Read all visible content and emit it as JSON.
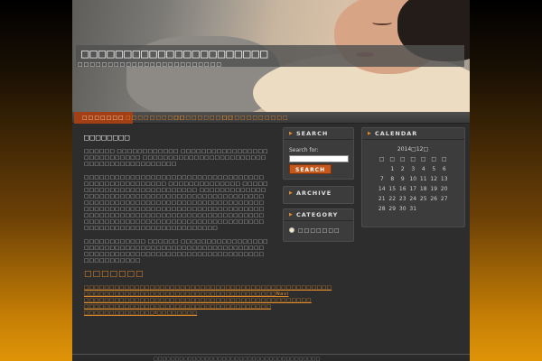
{
  "site": {
    "title": "□□□□□□□□□□□□□□□□□□□□□□",
    "description": "□□□□□□□□□□□□□□□□□□□□□□□□"
  },
  "nav": {
    "items": [
      {
        "label": "□□□□□□□",
        "active": true
      },
      {
        "label": "□□□□□□□□□□",
        "active": false
      },
      {
        "label": "□□□□□□□□□□",
        "active": false
      },
      {
        "label": "□□□□□□□",
        "active": false
      },
      {
        "label": "□□□□",
        "active": false
      }
    ]
  },
  "content": {
    "title": "□□□□□□□□",
    "paragraphs": [
      "□□□□□□ □□□□□□□□□□□□ □□□□□□□□□□□□□□□□□□□□□□□□□□□□ □□□□□□□□□□□□□□□□□□□□□□□□ □□□□□□□□□□□□□□□□□□",
      "□□□□□□□□□□□□□□□□□□□□□□□□□□□□□□□□□□□□□□□□□□□□□□□□□□□ □□□□□□□□□□□□□□ □□□□□□□□□□□□□□□□□□□□□□□□□□□ □□□□□□□□□□□□□□□□□□□□□□□□□□□□□□□□□□□□□□□□□□□□□□□□□□□□□□□□□□□□□□□□□□□□□□□□□□□□□□□□□□□□□□□□□□□□□□□□□□□□□□□□□□□□□□□□□□□□□□□□□□□□□□□□□□□□□□□□□□□□□□□□□□□□□□□□□□□□□□□□□□□□□□□□□□□□□□□□□□□□□□□□□□□□□□□□□□□□□□□□□□□□□□□□□□□□□□",
      "□□□□□□□□□□□□ □□□□□□ □□□□□□□□□□□□□□□□□□□□□□□□□□□□□□□□□□□□□□□□□□□□□□□□□□□□□□□□□□□□□□□□□□□□□□□□□□□□□□□□□□□□□□□□□□□□□□□□□□"
    ],
    "subtitle": "□□□□□□□",
    "links": [
      "□□□□□□□□□□□□□□□□□□□□□□□□□□□□□□□□□□□□□□□□□□□□□□□□□",
      "□□□□□□□□□□□□□□□□□□□□□□□□□□□□□□□□□□□□□□Navi",
      "□□□□□□□□□□□□□□□□□□□□□□□□□□□□□□□□□□□□□□□□□□□□□",
      "□□□□□□□□□□□□□□□□□□□□□□□□□□□□□□□□□□□□□",
      "□□□□□□□□□□□□□□I□□□□□□□□"
    ]
  },
  "sidebar": {
    "search": {
      "title": "SEARCH",
      "label": "Search for:",
      "button": "SEARCH",
      "value": ""
    },
    "archive": {
      "title": "ARCHIVE"
    },
    "category": {
      "title": "CATEGORY",
      "item": "□□□□□□□"
    },
    "calendar": {
      "title": "CALENDAR",
      "caption": "2014□12□",
      "weekdays": [
        "□",
        "□",
        "□",
        "□",
        "□",
        "□",
        "□"
      ],
      "weeks": [
        [
          "",
          "1",
          "2",
          "3",
          "4",
          "5",
          "6"
        ],
        [
          "7",
          "8",
          "9",
          "10",
          "11",
          "12",
          "13"
        ],
        [
          "14",
          "15",
          "16",
          "17",
          "18",
          "19",
          "20"
        ],
        [
          "21",
          "22",
          "23",
          "24",
          "25",
          "26",
          "27"
        ],
        [
          "28",
          "29",
          "30",
          "31",
          "",
          "",
          ""
        ]
      ]
    }
  },
  "footer": {
    "text": "□□□□□□□□□□□□□□□□□□□□□□□□□□□□□□□□□□□□□□□"
  },
  "colors": {
    "accent": "#e08a2c",
    "nav_active": "#a33f15",
    "button": "#c4581d"
  }
}
